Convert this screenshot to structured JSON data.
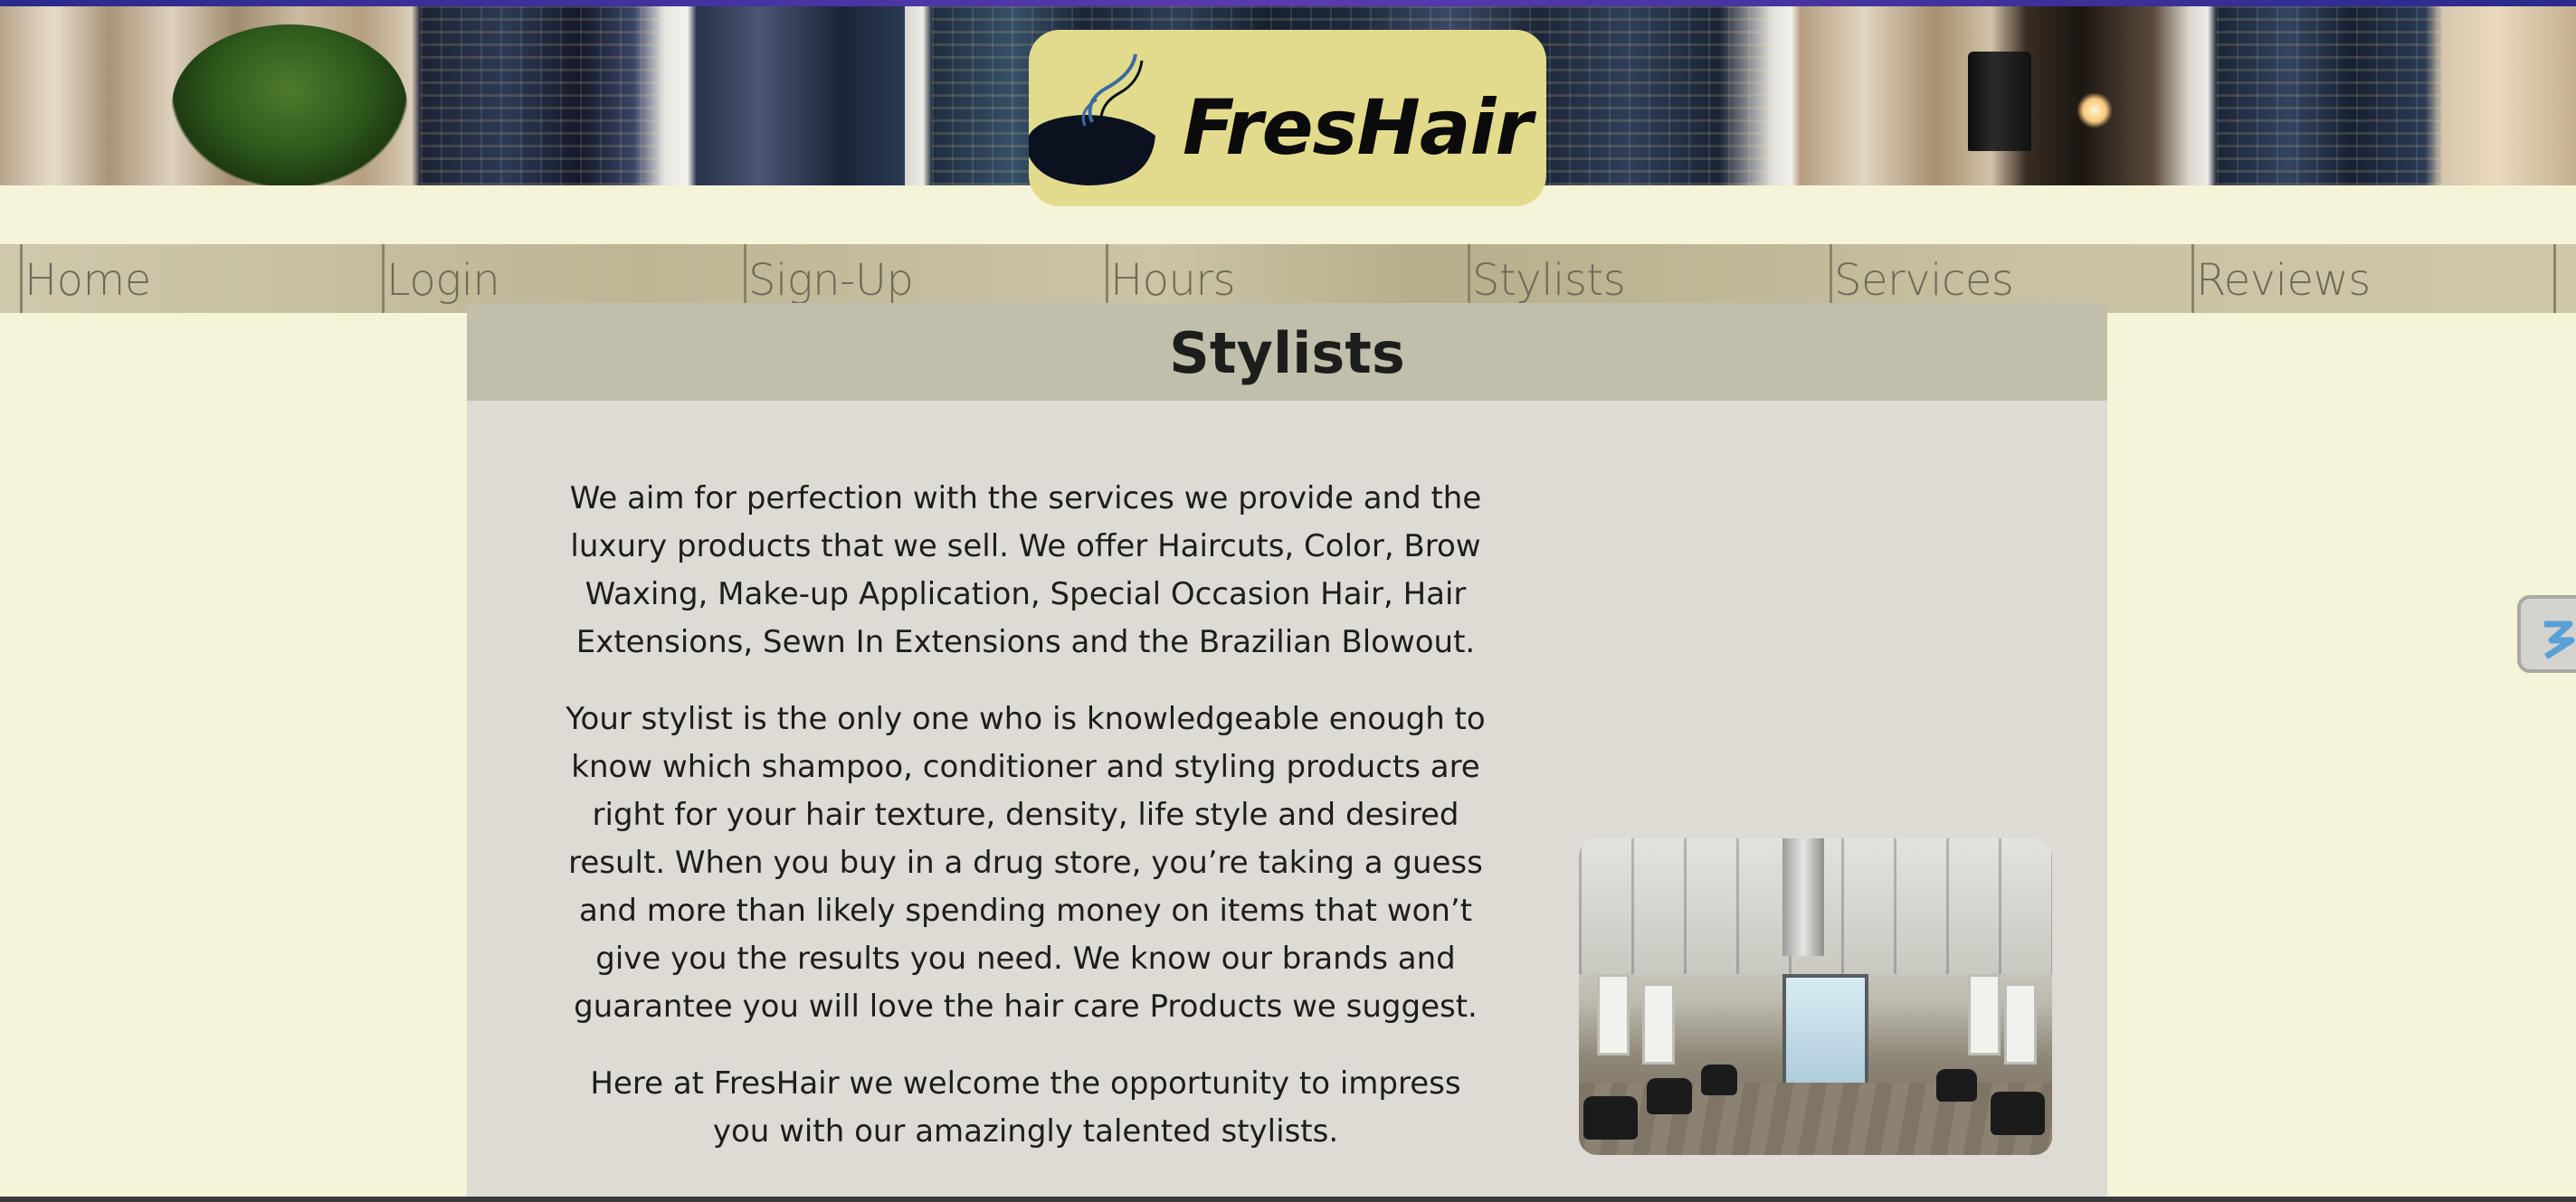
{
  "header": {
    "logo_text": "FresHair",
    "logo_icon": "steaming-bowl-icon"
  },
  "nav": {
    "items": [
      {
        "label": "Home"
      },
      {
        "label": "Login"
      },
      {
        "label": "Sign-Up"
      },
      {
        "label": "Hours"
      },
      {
        "label": "Stylists"
      },
      {
        "label": "Services"
      },
      {
        "label": "Reviews"
      }
    ]
  },
  "main": {
    "title": "Stylists",
    "paragraphs": [
      "We aim for perfection with the services we provide and the luxury products that we sell. We offer Haircuts, Color, Brow Waxing, Make-up Application, Special Occasion Hair, Hair Extensions, Sewn In Extensions and the Brazilian Blowout.",
      "Your stylist is the only one who is knowledgeable enough to know which shampoo, conditioner and styling products are right for your hair texture, density, life style and desired result. When you buy in a drug store, you’re taking a guess and more than likely spending money on items that won’t give you the results you need. We know our brands and guarantee you will love the hair care Products we suggest.",
      "Here at FresHair we welcome the opportunity to impress you with our amazingly talented stylists."
    ],
    "photo_subject": "salon-interior"
  },
  "side_widget": {
    "icon": "extension-s-icon"
  },
  "colors": {
    "page_bg": "#f5f4d8",
    "logo_bg": "#e3db8c",
    "nav_bg": "#c1bfab",
    "panel_bg": "#dddbd3",
    "header_bg": "#c1bfab"
  }
}
